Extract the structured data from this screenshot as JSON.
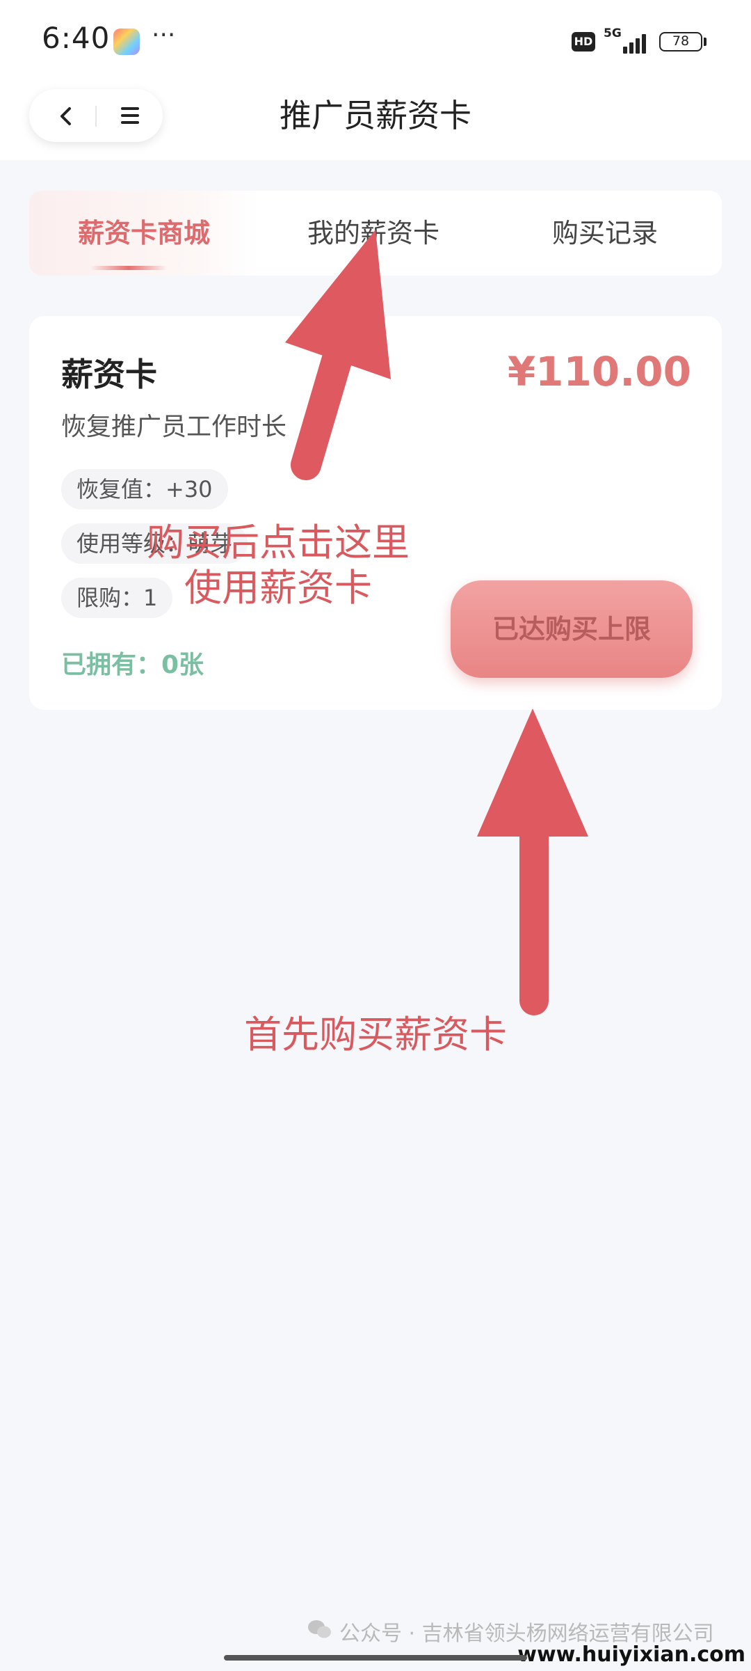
{
  "status_bar": {
    "time": "6:40",
    "more": "···",
    "hd": "HD",
    "network": "5G",
    "battery": "78"
  },
  "header": {
    "title": "推广员薪资卡",
    "back_icon": "chevron-left-icon",
    "menu_icon": "menu-icon"
  },
  "tabs": [
    {
      "label": "薪资卡商城",
      "active": true
    },
    {
      "label": "我的薪资卡",
      "active": false
    },
    {
      "label": "购买记录",
      "active": false
    }
  ],
  "card": {
    "title": "薪资卡",
    "price": "¥110.00",
    "description": "恢复推广员工作时长",
    "chips": [
      "恢复值：+30",
      "使用等级：萌芽",
      "限购：1"
    ],
    "owned": "已拥有：0张",
    "button_label": "已达购买上限"
  },
  "annotations": {
    "top_line1": "购买后点击这里",
    "top_line2": "使用薪资卡",
    "bottom": "首先购买薪资卡"
  },
  "footer": {
    "watermark": "公众号 · 吉林省领头杨网络运营有限公司",
    "site": "www.huiyixian.com"
  },
  "colors": {
    "accent": "#e07878",
    "annotation": "#d85a5e",
    "owned": "#7bbfa3",
    "background": "#f6f7fb"
  }
}
